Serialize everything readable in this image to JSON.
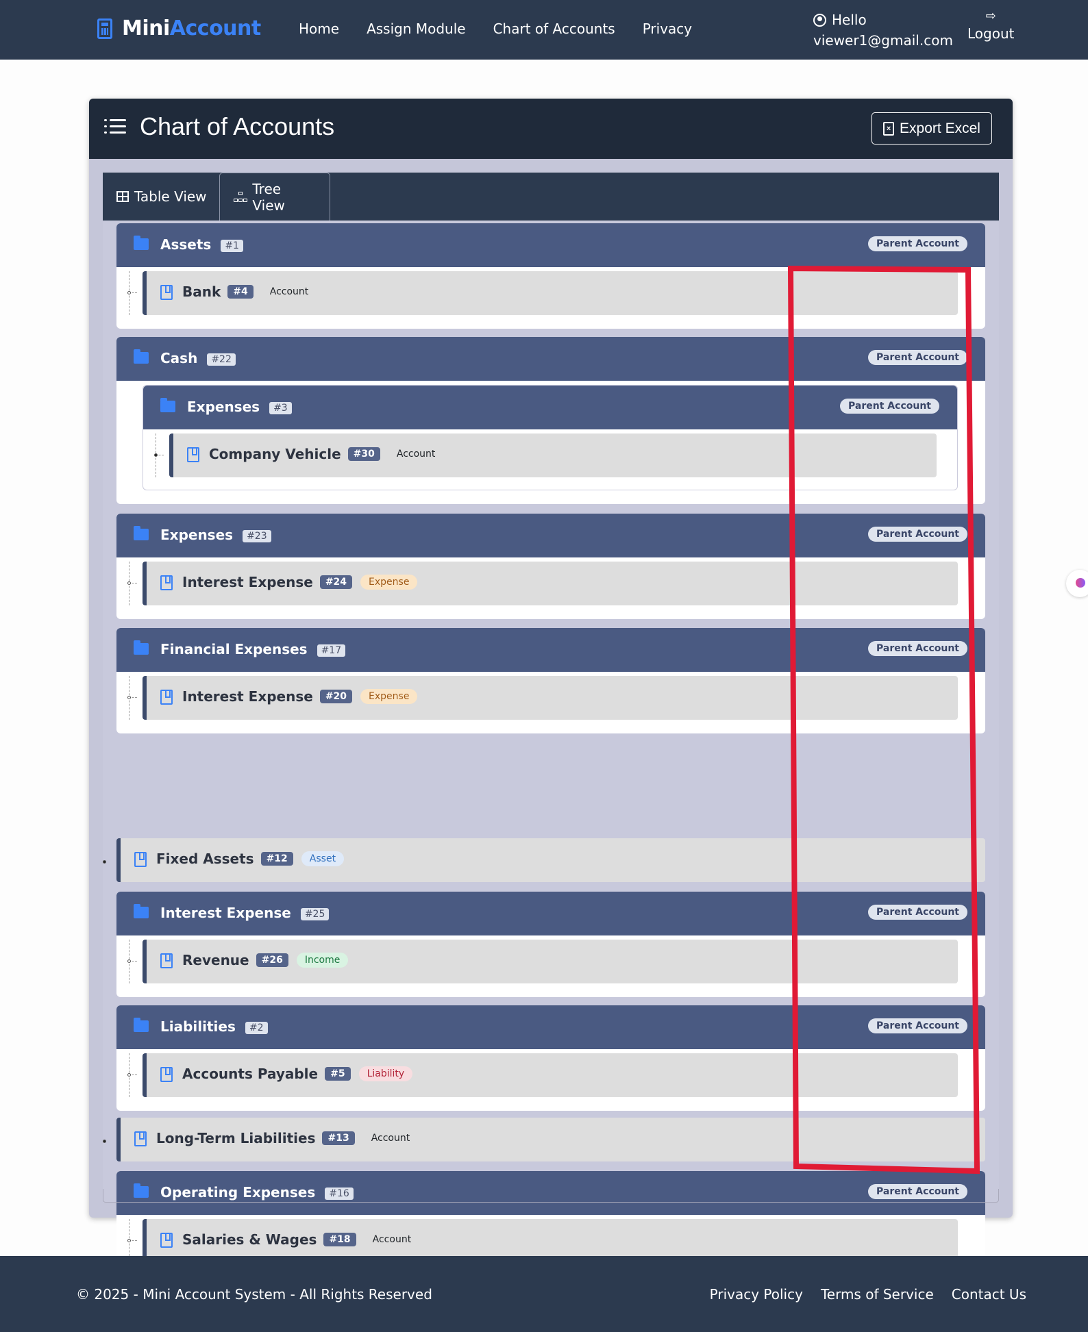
{
  "brand": {
    "mini": "Mini",
    "account": "Account"
  },
  "nav": {
    "links": [
      "Home",
      "Assign Module",
      "Chart of Accounts",
      "Privacy"
    ]
  },
  "user": {
    "greeting": "Hello",
    "email": "viewer1@gmail.com",
    "logout": "Logout"
  },
  "page": {
    "title": "Chart of Accounts",
    "export_label": "Export Excel"
  },
  "tabs": {
    "table": "Table View",
    "tree": "Tree View"
  },
  "parent_label": "Parent Account",
  "groups": [
    {
      "name": "Assets",
      "id": "#1",
      "children": [
        {
          "name": "Bank",
          "id": "#4",
          "type": "Account"
        }
      ]
    },
    {
      "name": "Cash",
      "id": "#22",
      "subgroup": {
        "name": "Expenses",
        "id": "#3",
        "children": [
          {
            "name": "Company Vehicle",
            "id": "#30",
            "type": "Account"
          }
        ]
      }
    },
    {
      "name": "Expenses",
      "id": "#23",
      "children": [
        {
          "name": "Interest Expense",
          "id": "#24",
          "type": "Expense"
        }
      ]
    },
    {
      "name": "Financial Expenses",
      "id": "#17",
      "children": [
        {
          "name": "Interest Expense",
          "id": "#20",
          "type": "Expense"
        }
      ]
    },
    {
      "name": "Fixed Assets",
      "id": "#12",
      "type": "Asset"
    },
    {
      "name": "Interest Expense",
      "id": "#25",
      "children": [
        {
          "name": "Revenue",
          "id": "#26",
          "type": "Income"
        }
      ]
    },
    {
      "name": "Liabilities",
      "id": "#2",
      "children": [
        {
          "name": "Accounts Payable",
          "id": "#5",
          "type": "Liability"
        }
      ]
    },
    {
      "name": "Long-Term Liabilities",
      "id": "#13",
      "type": "Account"
    },
    {
      "name": "Operating Expenses",
      "id": "#16",
      "children": [
        {
          "name": "Salaries & Wages",
          "id": "#18",
          "type": "Account"
        }
      ]
    }
  ],
  "colors": {
    "nav_bg": "#2c3a4f",
    "accent": "#3b82f6",
    "group_header": "#4a5a82",
    "annotation_red": "#e01a35"
  },
  "footer": {
    "copyright": "© 2025 - Mini Account System - All Rights Reserved",
    "links": [
      "Privacy Policy",
      "Terms of Service",
      "Contact Us"
    ]
  }
}
